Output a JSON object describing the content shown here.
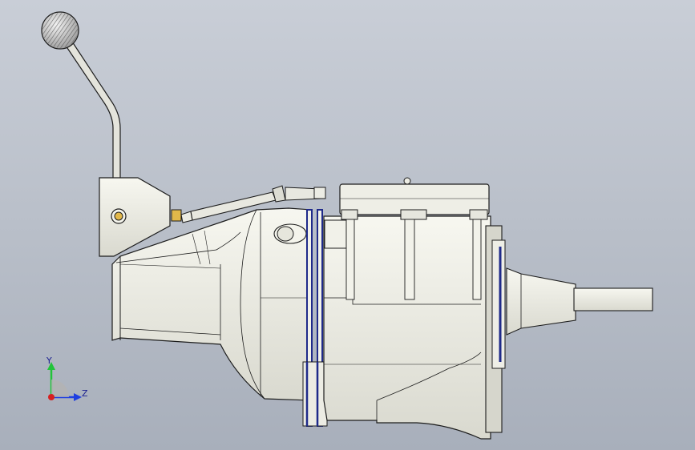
{
  "viewport": {
    "background_top": "#c9ced7",
    "background_bottom": "#a8afbb"
  },
  "model": {
    "name": "transmission-assembly",
    "body_color": "#ecece4",
    "outline_color": "#1c1c1c",
    "seal_color": "#1f2a8a",
    "brass_color": "#e2b84a"
  },
  "triad": {
    "y_label": "Y",
    "z_label": "Z",
    "y_color": "#22c33a",
    "z_color": "#1f3fe0",
    "x_color": "#d62020"
  }
}
